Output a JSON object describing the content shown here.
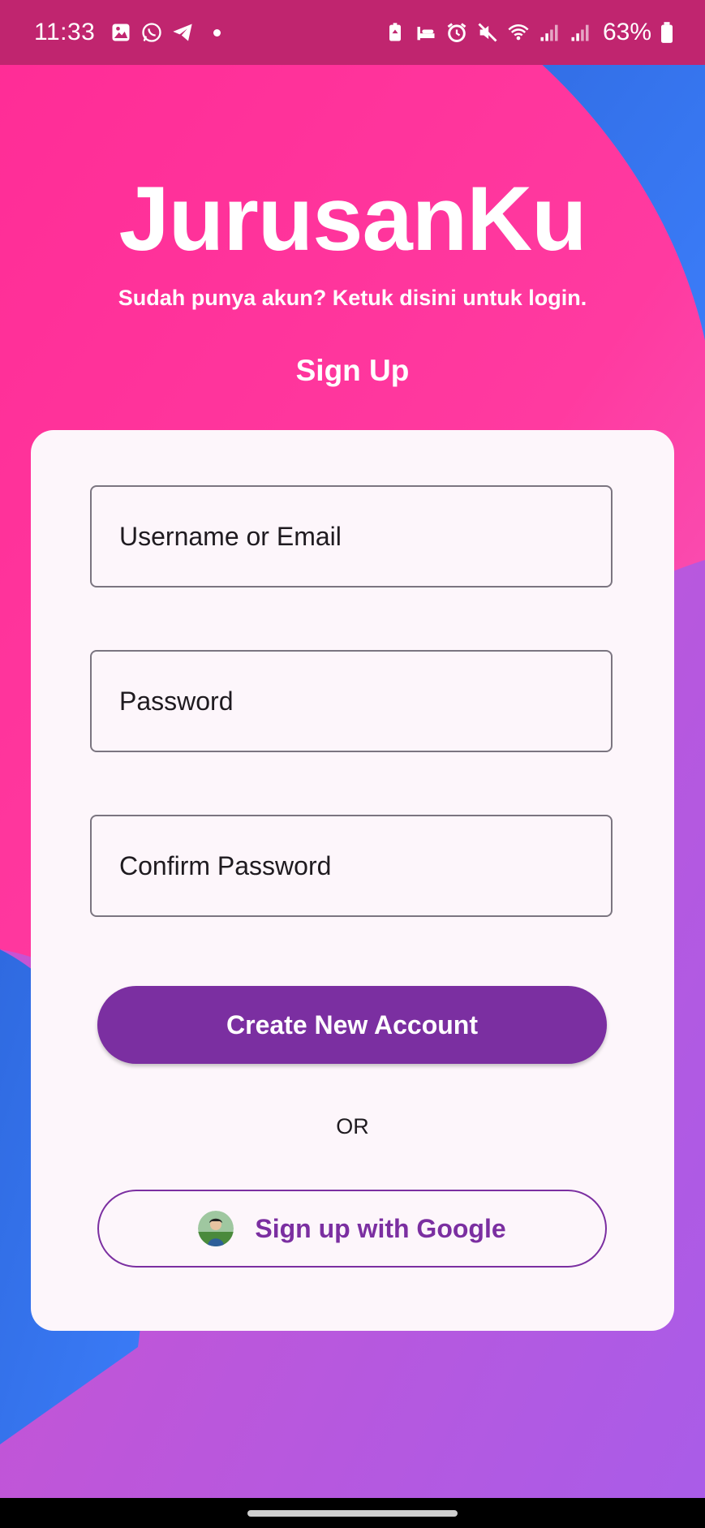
{
  "status_bar": {
    "time": "11:33",
    "battery": "63%",
    "left_icons": [
      "gallery-icon",
      "whatsapp-icon",
      "telegram-icon",
      "dot"
    ],
    "right_icons": [
      "battery-saver-icon",
      "sleep-icon",
      "alarm-icon",
      "mute-icon",
      "wifi-icon",
      "signal-icon",
      "signal-icon",
      "battery-icon"
    ]
  },
  "header": {
    "app_title": "JurusanKu",
    "login_hint": "Sudah punya akun? Ketuk disini untuk login.",
    "page_title": "Sign Up"
  },
  "form": {
    "username_placeholder": "Username or Email",
    "password_placeholder": "Password",
    "confirm_password_placeholder": "Confirm Password",
    "create_account_label": "Create New Account",
    "or_label": "OR",
    "google_label": "Sign up with Google"
  },
  "colors": {
    "status_bar": "#c0256f",
    "pink": "#ff2f9a",
    "blue": "#3a7af5",
    "purple_bg": "#b45be6",
    "card": "#fdf6fb",
    "primary": "#7b2fa1"
  }
}
